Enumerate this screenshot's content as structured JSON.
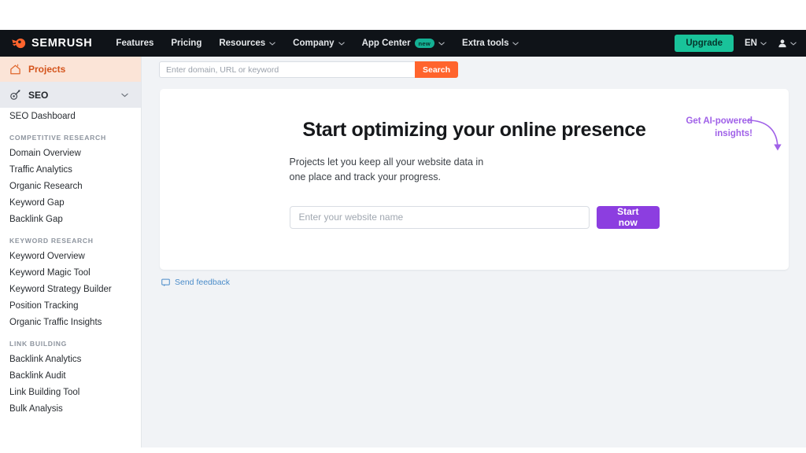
{
  "brand": {
    "name": "SEMRUSH",
    "logo_icon": "semrush-comet-icon",
    "accent_orange": "#ff642d",
    "accent_purple": "#8c3ee0",
    "accent_green": "#19c39a",
    "nav_background": "#0f1318"
  },
  "global_nav": {
    "items": [
      {
        "label": "Features",
        "has_caret": false,
        "badge": null
      },
      {
        "label": "Pricing",
        "has_caret": false,
        "badge": null
      },
      {
        "label": "Resources",
        "has_caret": true,
        "badge": null
      },
      {
        "label": "Company",
        "has_caret": true,
        "badge": null
      },
      {
        "label": "App Center",
        "has_caret": true,
        "badge": "new"
      },
      {
        "label": "Extra tools",
        "has_caret": true,
        "badge": null
      }
    ],
    "upgrade_label": "Upgrade",
    "language": "EN",
    "account_icon": "user-avatar-icon",
    "caret_icon": "chevron-down-icon"
  },
  "sidebar": {
    "projects": {
      "label": "Projects",
      "icon": "home-icon",
      "active": true
    },
    "seo": {
      "label": "SEO",
      "icon": "seo-rocket-icon",
      "expanded": true,
      "caret": "chevron-down-icon"
    },
    "dashboard": {
      "label": "SEO Dashboard"
    },
    "groups": [
      {
        "title": "COMPETITIVE RESEARCH",
        "items": [
          "Domain Overview",
          "Traffic Analytics",
          "Organic Research",
          "Keyword Gap",
          "Backlink Gap"
        ]
      },
      {
        "title": "KEYWORD RESEARCH",
        "items": [
          "Keyword Overview",
          "Keyword Magic Tool",
          "Keyword Strategy Builder",
          "Position Tracking",
          "Organic Traffic Insights"
        ]
      },
      {
        "title": "LINK BUILDING",
        "items": [
          "Backlink Analytics",
          "Backlink Audit",
          "Link Building Tool",
          "Bulk Analysis"
        ]
      }
    ]
  },
  "search": {
    "placeholder": "Enter domain, URL or keyword",
    "value": "",
    "button_label": "Search"
  },
  "main": {
    "title": "Start optimizing your online presence",
    "subtitle": "Projects let you keep all your website data in one place and track your progress.",
    "promo_line1": "Get AI-powered",
    "promo_line2": "insights!",
    "promo_arrow_icon": "curved-arrow-down-icon",
    "website_placeholder": "Enter your website name",
    "website_value": "",
    "start_label": "Start now"
  },
  "footer": {
    "feedback_label": "Send feedback",
    "feedback_icon": "speech-bubble-icon"
  }
}
